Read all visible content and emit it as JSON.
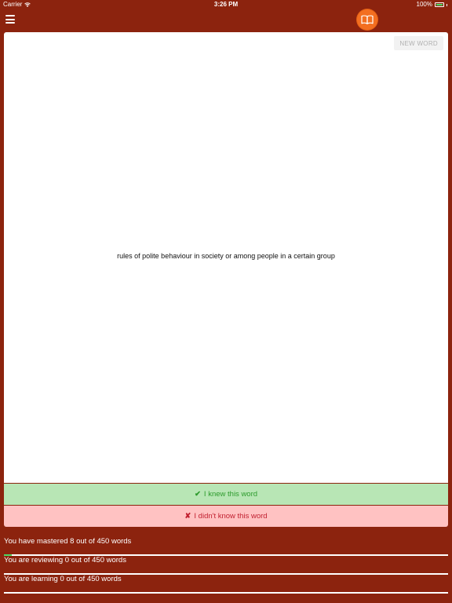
{
  "status_bar": {
    "carrier": "Carrier",
    "time": "3:26 PM",
    "battery": "100%"
  },
  "nav": {
    "menu_icon": "hamburger-menu-icon",
    "logo_icon": "open-book-icon",
    "logo_color": "#f36f21"
  },
  "card": {
    "new_word_label": "NEW WORD",
    "definition": "rules of polite behaviour in society or among people in a certain group"
  },
  "actions": {
    "knew_mark": "✔",
    "knew_label": "I knew this word",
    "didnt_mark": "✘",
    "didnt_label": "I didn't know this word"
  },
  "progress": [
    {
      "text": "You have mastered 8 out of 450 words",
      "fraction": 0.0178
    },
    {
      "text": "You are reviewing 0 out of 450 words",
      "fraction": 0
    },
    {
      "text": "You are learning 0 out of 450 words",
      "fraction": 0
    }
  ],
  "colors": {
    "background": "#8c230e",
    "knew_bg": "#b8e6b5",
    "didnt_bg": "#ffc2c2",
    "progress_fill": "#4cd964"
  }
}
